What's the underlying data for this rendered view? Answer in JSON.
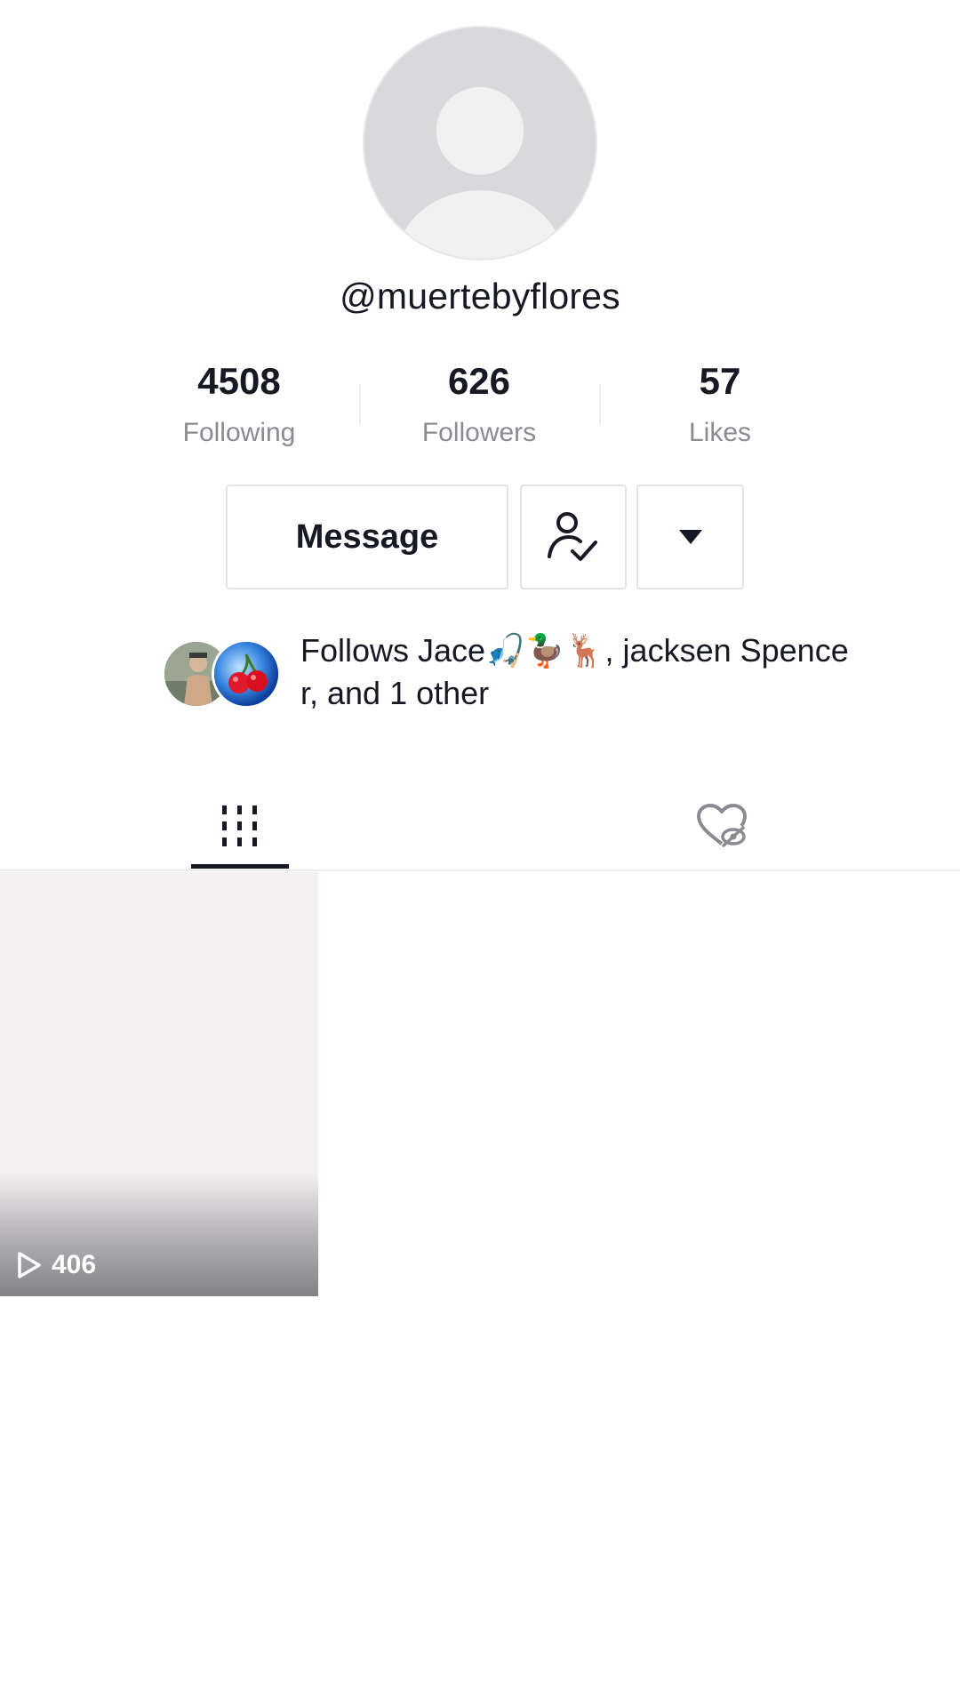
{
  "profile": {
    "username": "@muertebyflores"
  },
  "stats": [
    {
      "value": "4508",
      "label": "Following"
    },
    {
      "value": "626",
      "label": "Followers"
    },
    {
      "value": "57",
      "label": "Likes"
    }
  ],
  "actions": {
    "message_label": "Message",
    "friends_icon": "user-check-icon",
    "more_icon": "caret-down-icon"
  },
  "follows": {
    "prefix": "Follows ",
    "text": "Jace🎣🦆🦌, jacksen Spencer, and 1 other"
  },
  "tabs": [
    {
      "name": "videos",
      "icon": "grid-icon",
      "active": true
    },
    {
      "name": "liked",
      "icon": "hidden-heart-icon",
      "active": false
    }
  ],
  "videos": [
    {
      "play_count": "406"
    }
  ]
}
